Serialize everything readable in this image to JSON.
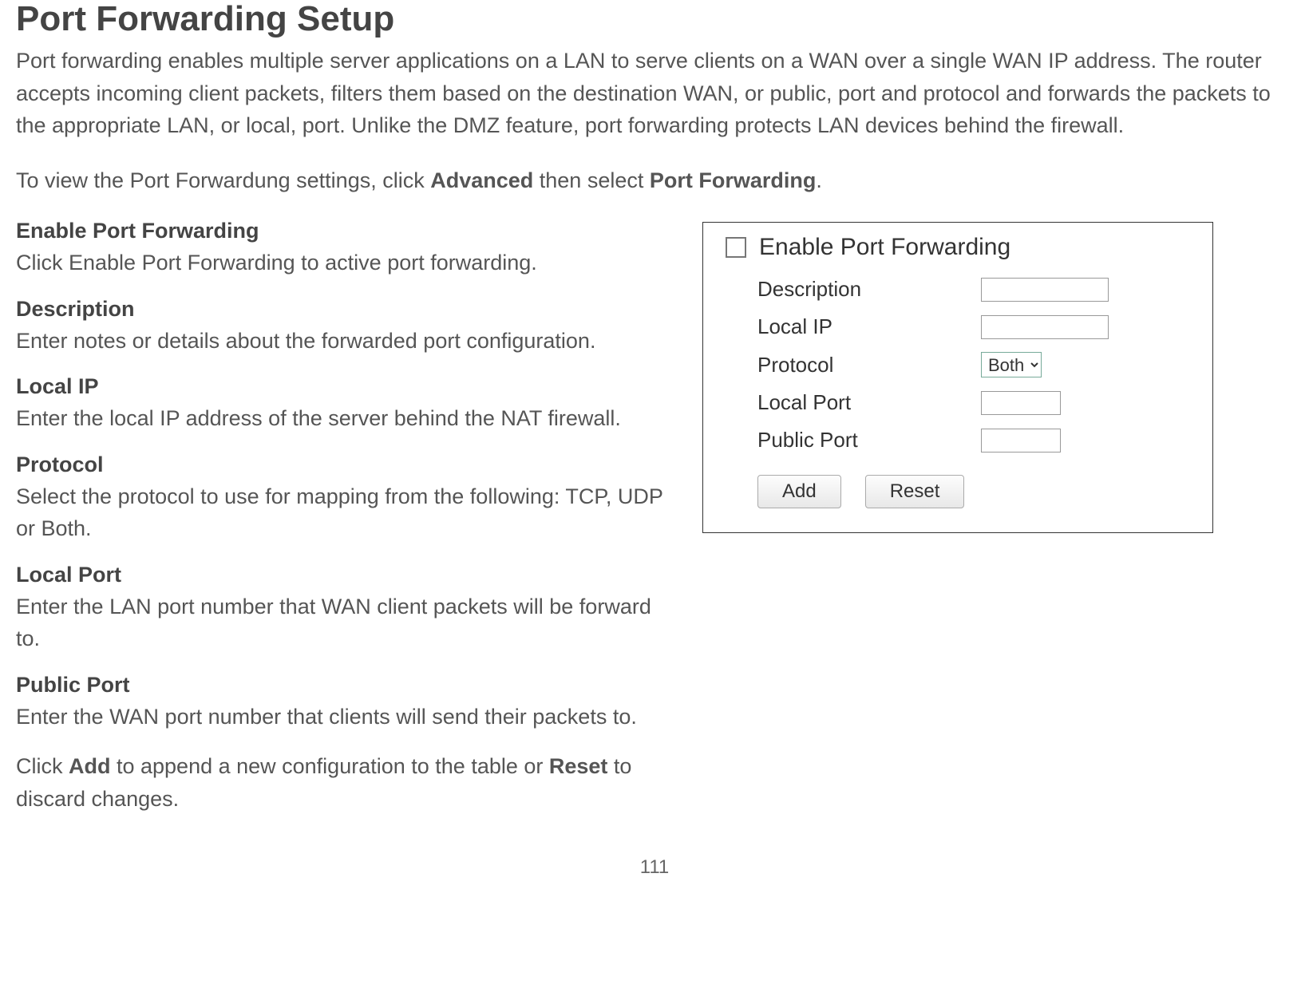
{
  "title": "Port Forwarding Setup",
  "intro": "Port forwarding enables multiple server applications on a LAN to serve clients on a WAN over a single WAN IP address. The router accepts incoming client packets, filters them based on the destination WAN, or public, port and protocol and forwards the packets to the appropriate LAN, or local, port. Unlike the DMZ feature, port forwarding protects LAN devices behind the firewall.",
  "nav_prefix": "To view the Port Forwardung settings, click ",
  "nav_bold1": "Advanced",
  "nav_mid": " then select ",
  "nav_bold2": "Port Forwarding",
  "nav_suffix": ".",
  "definitions": [
    {
      "term": "Enable Port Forwarding",
      "desc": "Click Enable Port Forwarding to active port forwarding."
    },
    {
      "term": "Description",
      "desc": "Enter notes or details about the forwarded port configuration."
    },
    {
      "term": "Local IP",
      "desc": "Enter the local IP address of the server behind the NAT firewall."
    },
    {
      "term": "Protocol",
      "desc": "Select the protocol to use for mapping from the following: TCP, UDP or Both."
    },
    {
      "term": "Local Port",
      "desc": "Enter the LAN port number that WAN client packets will be forward to."
    },
    {
      "term": "Public Port",
      "desc": "Enter the WAN port number that clients will send their packets to."
    }
  ],
  "closing_prefix": "Click ",
  "closing_bold1": "Add",
  "closing_mid": " to append a new configuration to the table or ",
  "closing_bold2": "Reset",
  "closing_suffix": " to discard changes.",
  "panel": {
    "enable_label": "Enable Port Forwarding",
    "description_label": "Description",
    "local_ip_label": "Local IP",
    "protocol_label": "Protocol",
    "protocol_value": "Both",
    "local_port_label": "Local Port",
    "public_port_label": "Public Port",
    "add_button": "Add",
    "reset_button": "Reset"
  },
  "page_number": "111"
}
